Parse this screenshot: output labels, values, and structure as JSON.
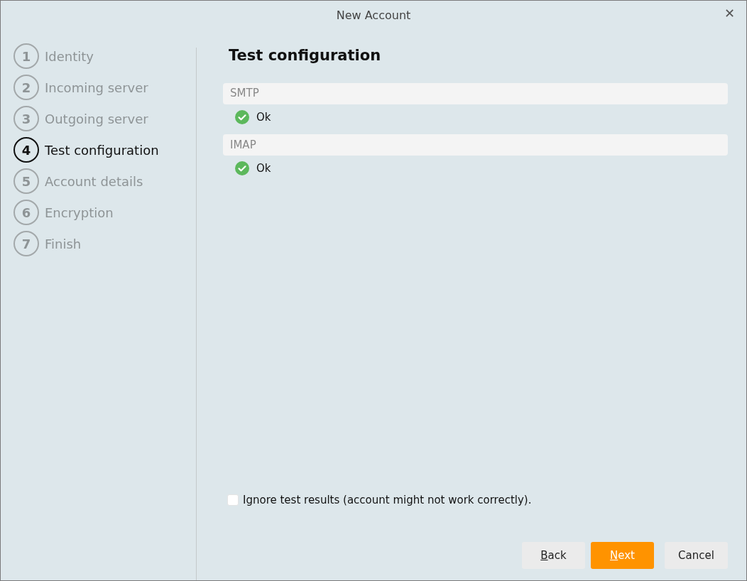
{
  "window": {
    "title": "New Account",
    "close": "✕"
  },
  "steps": [
    {
      "number": "1",
      "label": "Identity",
      "selected": false
    },
    {
      "number": "2",
      "label": "Incoming server",
      "selected": false
    },
    {
      "number": "3",
      "label": "Outgoing server",
      "selected": false
    },
    {
      "number": "4",
      "label": "Test configuration",
      "selected": true
    },
    {
      "number": "5",
      "label": "Account details",
      "selected": false
    },
    {
      "number": "6",
      "label": "Encryption",
      "selected": false
    },
    {
      "number": "7",
      "label": "Finish",
      "selected": false
    }
  ],
  "page": {
    "title": "Test configuration",
    "sections": [
      {
        "header": "SMTP",
        "result": {
          "kind": "ok",
          "text": "Ok"
        }
      },
      {
        "header": "IMAP",
        "result": {
          "kind": "ok",
          "text": "Ok"
        }
      }
    ],
    "ignore_checkbox": {
      "label": "Ignore test results (account might not work correctly).",
      "checked": false
    }
  },
  "buttons": [
    {
      "label": "Back",
      "kind": "default",
      "mnemonic": true
    },
    {
      "label": "Next",
      "kind": "primary",
      "mnemonic": true
    },
    {
      "label": "Cancel",
      "kind": "default",
      "mnemonic": false
    }
  ]
}
